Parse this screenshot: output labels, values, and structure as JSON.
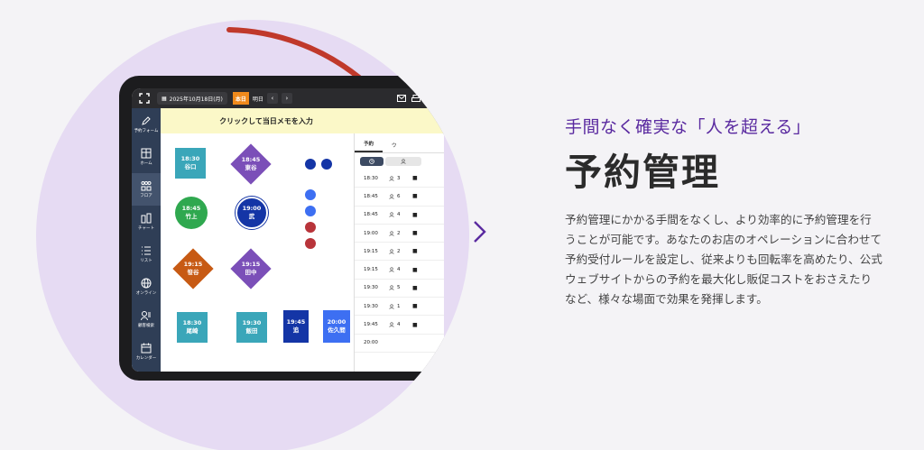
{
  "topbar": {
    "date": "2025年10月18日(月)",
    "today_label": "本日",
    "tomorrow_label": "明日",
    "prev": "‹",
    "next": "›"
  },
  "sidebar": {
    "items": [
      {
        "label": "予約フォーム",
        "icon": "pen-icon"
      },
      {
        "label": "ホーム",
        "icon": "home-grid-icon"
      },
      {
        "label": "フロア",
        "icon": "floor-icon"
      },
      {
        "label": "チャート",
        "icon": "chart-icon"
      },
      {
        "label": "リスト",
        "icon": "list-icon"
      },
      {
        "label": "オンライン",
        "icon": "globe-icon"
      },
      {
        "label": "顧客検索",
        "icon": "customer-search-icon"
      },
      {
        "label": "カレンダー",
        "icon": "calendar-icon"
      }
    ]
  },
  "memo": {
    "placeholder": "クリックして当日メモを入力"
  },
  "floor": {
    "tables": [
      {
        "time": "18:30",
        "name": "谷口"
      },
      {
        "time": "18:45",
        "name": "東谷"
      },
      {
        "time": "18:45",
        "name": "竹上"
      },
      {
        "time": "19:00",
        "name": "武"
      },
      {
        "time": "19:15",
        "name": "笹谷"
      },
      {
        "time": "19:15",
        "name": "田中"
      },
      {
        "time": "18:30",
        "name": "尾崎"
      },
      {
        "time": "19:30",
        "name": "飯田"
      },
      {
        "time": "19:45",
        "name": "追"
      },
      {
        "time": "20:00",
        "name": "佐久間"
      }
    ]
  },
  "panel": {
    "tabs": [
      "予約",
      "ウ"
    ],
    "reservations": [
      {
        "time": "18:30",
        "people": "3"
      },
      {
        "time": "18:45",
        "people": "6"
      },
      {
        "time": "18:45",
        "people": "4"
      },
      {
        "time": "19:00",
        "people": "2"
      },
      {
        "time": "19:15",
        "people": "2"
      },
      {
        "time": "19:15",
        "people": "4"
      },
      {
        "time": "19:30",
        "people": "5"
      },
      {
        "time": "19:30",
        "people": "1"
      },
      {
        "time": "19:45",
        "people": "4"
      },
      {
        "time": "20:00",
        "people": ""
      }
    ]
  },
  "content": {
    "tagline": "手間なく確実な「人を超える」",
    "heading": "予約管理",
    "description": "予約管理にかかる手間をなくし、より効率的に予約管理を行うことが可能です。あなたのお店のオペレーションに合わせて予約受付ルールを設定し、従来よりも回転率を高めたり、公式ウェブサイトからの予約を最大化し販促コストをおさえたりなど、様々な場面で効果を発揮します。"
  },
  "colors": {
    "accent": "#5a2aa0",
    "arc": "#c0392b",
    "circle_bg": "#e6dbf3",
    "teal": "#3aa6b9",
    "purple": "#7b4fb8",
    "green": "#2fa84f",
    "navy": "#1435a6",
    "orange": "#c75a14",
    "blue": "#3d6ff2"
  }
}
